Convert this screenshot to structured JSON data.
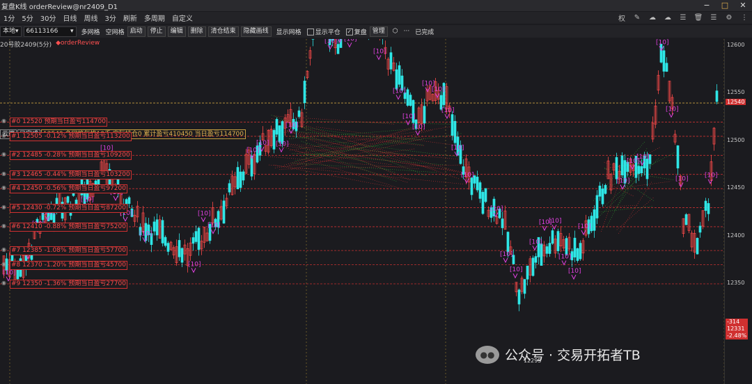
{
  "window": {
    "title": "复盘K线 orderReview@nr2409_D1"
  },
  "window_controls": [
    "−",
    "□",
    "✕"
  ],
  "menu": [
    "1分",
    "5分",
    "30分",
    "日线",
    "周线",
    "3分",
    "刷新",
    "多周期",
    "自定义"
  ],
  "menu_right": [
    "权",
    "✎",
    "☁",
    "☁",
    "☰",
    "🗑",
    "☰",
    "⚙",
    "⋮"
  ],
  "toolbar": {
    "location": "本地",
    "account": "66113166",
    "buttons": [
      "多网格",
      "空网格",
      "启动",
      "停止",
      "编辑",
      "删除",
      "清仓结束",
      "隐藏画线",
      "显示网格"
    ],
    "show_flat": "显示平仓",
    "review": "复盘",
    "manage": "管理",
    "more": "···",
    "done": "已完成"
  },
  "chart_info": {
    "symbol": "20号胶2409(5分)",
    "strategy": "orderReview"
  },
  "status": {
    "a": "云端",
    "b": "已完成",
    "summary": "12540 多网格每格10手 实际持仓0 累计盈亏410450 当日盈亏114700"
  },
  "grid_levels": [
    {
      "label": "#0 12520 预期当日盈亏114700",
      "price": 12520
    },
    {
      "label": "#1 12505 -0.12% 预期当日盈亏113200",
      "price": 12505
    },
    {
      "label": "#2 12485 -0.28% 预期当日盈亏109200",
      "price": 12485
    },
    {
      "label": "#3 12465 -0.44% 预期当日盈亏103200",
      "price": 12465
    },
    {
      "label": "#4 12450 -0.56% 预期当日盈亏97200",
      "price": 12450
    },
    {
      "label": "#5 12430 -0.72% 预期当日盈亏87200",
      "price": 12430
    },
    {
      "label": "#6 12410 -0.88% 预期当日盈亏75200",
      "price": 12410
    },
    {
      "label": "#7 12385 -1.08% 预期当日盈亏57700",
      "price": 12385
    },
    {
      "label": "#8 12370 -1.20% 预期当日盈亏45700",
      "price": 12370
    },
    {
      "label": "#9 12350 -1.36% 预期当日盈亏27700",
      "price": 12350
    }
  ],
  "axis": {
    "ticks": [
      "12600",
      "12550",
      "12500",
      "12450",
      "12400",
      "12350"
    ],
    "last_price": "12540"
  },
  "bottom_box": {
    "change": "-314",
    "price": "12331",
    "pct": "-2.48%"
  },
  "low_label": "12295",
  "watermark": "公众号 · 交易开拓者TB",
  "order_tag": "[10]",
  "colors": {
    "up": "#ff4a4a",
    "down": "#2ee6e6",
    "order": "#e040e0",
    "grid": "#c83030"
  }
}
